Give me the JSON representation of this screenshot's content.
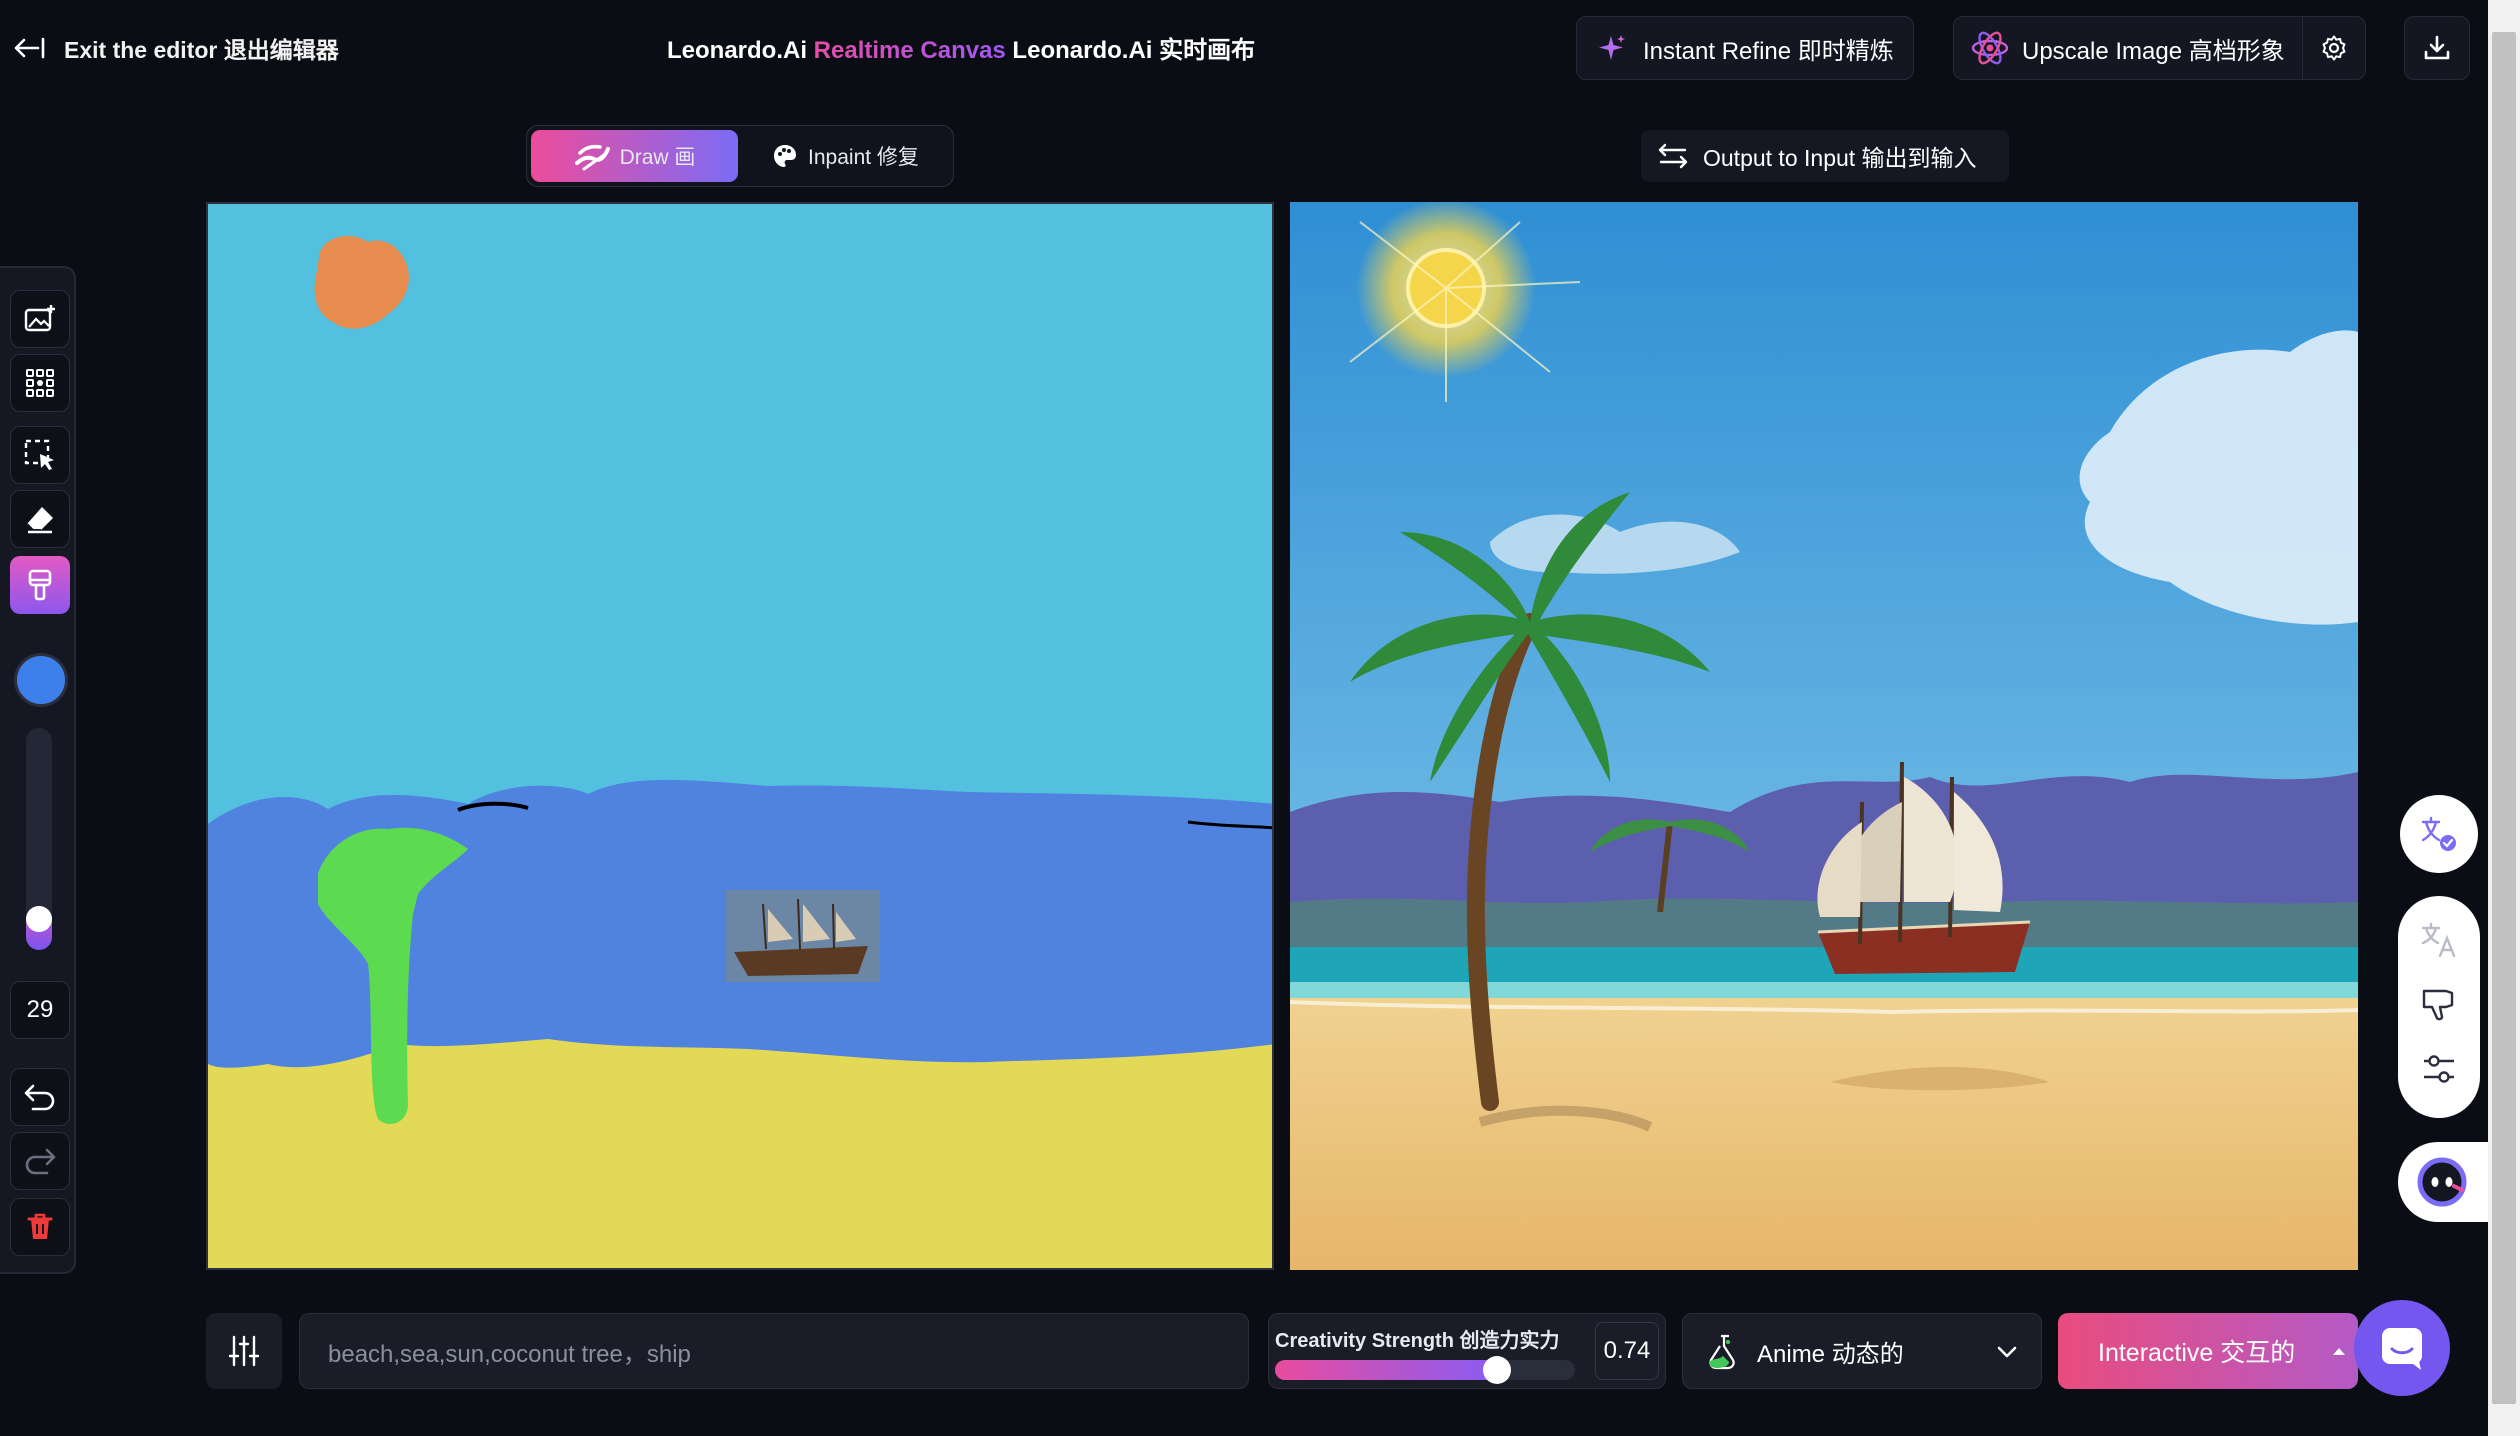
{
  "header": {
    "exit_label": "Exit the editor 退出编辑器",
    "title_prefix": "Leonardo.Ai ",
    "title_accent": "Realtime Canvas",
    "title_suffix": " Leonardo.Ai 实时画布",
    "refine_label": "Instant Refine 即时精炼",
    "upscale_label": "Upscale Image 高档形象"
  },
  "mode_tabs": [
    {
      "label": "Draw 画",
      "active": true
    },
    {
      "label": "Inpaint 修复",
      "active": false
    }
  ],
  "output_to_input_label": "Output to Input 输出到输入",
  "toolrail": {
    "tools": [
      "add-image",
      "focus-grid",
      "select",
      "eraser",
      "paint-brush"
    ],
    "active_tool": "paint-brush",
    "brush_color": "#3e80ea",
    "brush_size": "29",
    "brush_level": 0.08
  },
  "prompt": {
    "value": "beach,sea,sun,coconut tree，ship"
  },
  "creativity": {
    "label": "Creativity Strength 创造力实力",
    "value": "0.74",
    "level": 0.74
  },
  "style": {
    "label": "Anime 动态的"
  },
  "generate": {
    "label": "Interactive 交互的"
  },
  "colors": {
    "accent_pink": "#ed4c9b",
    "accent_purple": "#7b6cf6",
    "sky": "#53c0e0",
    "sea": "#5082e0",
    "sand": "#e2da56",
    "tree": "#5ddb50",
    "sun": "#e78b4f"
  }
}
